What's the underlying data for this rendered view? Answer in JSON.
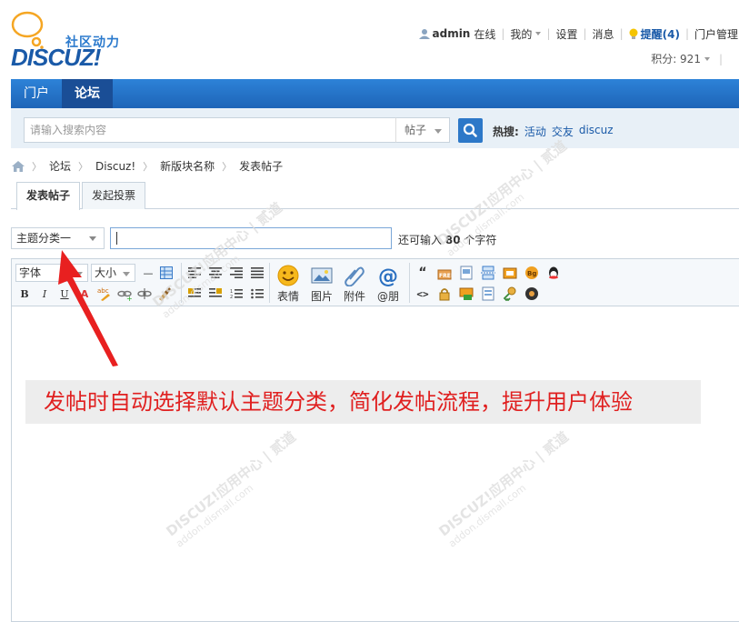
{
  "header": {
    "tagline": "社区动力",
    "brand": "DISCUZ!",
    "user_name": "admin",
    "online": "在线",
    "my": "我的",
    "settings": "设置",
    "messages": "消息",
    "remind": "提醒(4)",
    "portal_admin": "门户管理",
    "credit": "积分: 921"
  },
  "nav": {
    "items": [
      "门户",
      "论坛"
    ],
    "active_index": 1
  },
  "search": {
    "placeholder": "请输入搜索内容",
    "type": "帖子",
    "hot_label": "热搜:",
    "hot_items": [
      "活动",
      "交友",
      "discuz"
    ]
  },
  "breadcrumb": [
    "论坛",
    "Discuz!",
    "新版块名称",
    "发表帖子"
  ],
  "tabs": [
    "发表帖子",
    "发起投票"
  ],
  "subject": {
    "type_value": "主题分类一",
    "value": "",
    "tip_prefix": "还可输入",
    "tip_count": "80",
    "tip_suffix": "个字符"
  },
  "editor": {
    "font_select": "字体",
    "size_select": "大小",
    "btn_emoji": "表情",
    "btn_image": "图片",
    "btn_attach": "附件",
    "btn_at": "@朋"
  },
  "annotation": {
    "text": "发帖时自动选择默认主题分类，简化发帖流程，提升用户体验"
  },
  "watermark": {
    "line1": "DISCUZ!应用中心 | 贰道",
    "line2": "addon.dismall.com"
  },
  "colors": {
    "nav_bg": "#1e65b8",
    "link": "#1a5aa8",
    "annotation": "#e02020"
  }
}
